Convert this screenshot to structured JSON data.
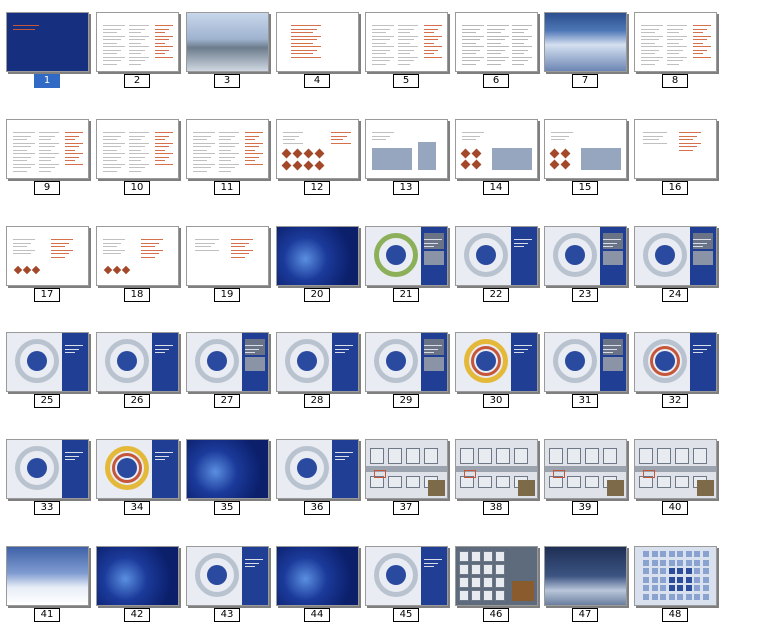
{
  "slides": [
    {
      "num": "1",
      "kind": "cover",
      "selected": true
    },
    {
      "num": "2",
      "kind": "text"
    },
    {
      "num": "3",
      "kind": "photo"
    },
    {
      "num": "4",
      "kind": "text-red"
    },
    {
      "num": "5",
      "kind": "text"
    },
    {
      "num": "6",
      "kind": "text-dense"
    },
    {
      "num": "7",
      "kind": "bridge"
    },
    {
      "num": "8",
      "kind": "text"
    },
    {
      "num": "9",
      "kind": "text"
    },
    {
      "num": "10",
      "kind": "text"
    },
    {
      "num": "11",
      "kind": "text"
    },
    {
      "num": "12",
      "kind": "diamonds"
    },
    {
      "num": "13",
      "kind": "elevation"
    },
    {
      "num": "14",
      "kind": "diamonds-elev"
    },
    {
      "num": "15",
      "kind": "diamonds-elev"
    },
    {
      "num": "16",
      "kind": "text-sparse"
    },
    {
      "num": "17",
      "kind": "diagram"
    },
    {
      "num": "18",
      "kind": "diagram"
    },
    {
      "num": "19",
      "kind": "text-sparse"
    },
    {
      "num": "20",
      "kind": "dark"
    },
    {
      "num": "21",
      "kind": "plan-color"
    },
    {
      "num": "22",
      "kind": "plan"
    },
    {
      "num": "23",
      "kind": "plan-photo"
    },
    {
      "num": "24",
      "kind": "plan-photo"
    },
    {
      "num": "25",
      "kind": "plan"
    },
    {
      "num": "26",
      "kind": "plan"
    },
    {
      "num": "27",
      "kind": "plan-photo"
    },
    {
      "num": "28",
      "kind": "plan"
    },
    {
      "num": "29",
      "kind": "plan-photo"
    },
    {
      "num": "30",
      "kind": "plan-yellow"
    },
    {
      "num": "31",
      "kind": "plan-photo"
    },
    {
      "num": "32",
      "kind": "plan-red"
    },
    {
      "num": "33",
      "kind": "plan"
    },
    {
      "num": "34",
      "kind": "plan-yellow"
    },
    {
      "num": "35",
      "kind": "dark"
    },
    {
      "num": "36",
      "kind": "plan"
    },
    {
      "num": "37",
      "kind": "streets"
    },
    {
      "num": "38",
      "kind": "streets"
    },
    {
      "num": "39",
      "kind": "streets"
    },
    {
      "num": "40",
      "kind": "streets"
    },
    {
      "num": "41",
      "kind": "snow"
    },
    {
      "num": "42",
      "kind": "dark"
    },
    {
      "num": "43",
      "kind": "plan"
    },
    {
      "num": "44",
      "kind": "dark"
    },
    {
      "num": "45",
      "kind": "plan"
    },
    {
      "num": "46",
      "kind": "aerial"
    },
    {
      "num": "47",
      "kind": "photo-dark"
    },
    {
      "num": "48",
      "kind": "bluegrid"
    }
  ],
  "colors": {
    "selection": "#316ac5",
    "accent_blue": "#1f3e94",
    "accent_red": "#c6563a"
  }
}
